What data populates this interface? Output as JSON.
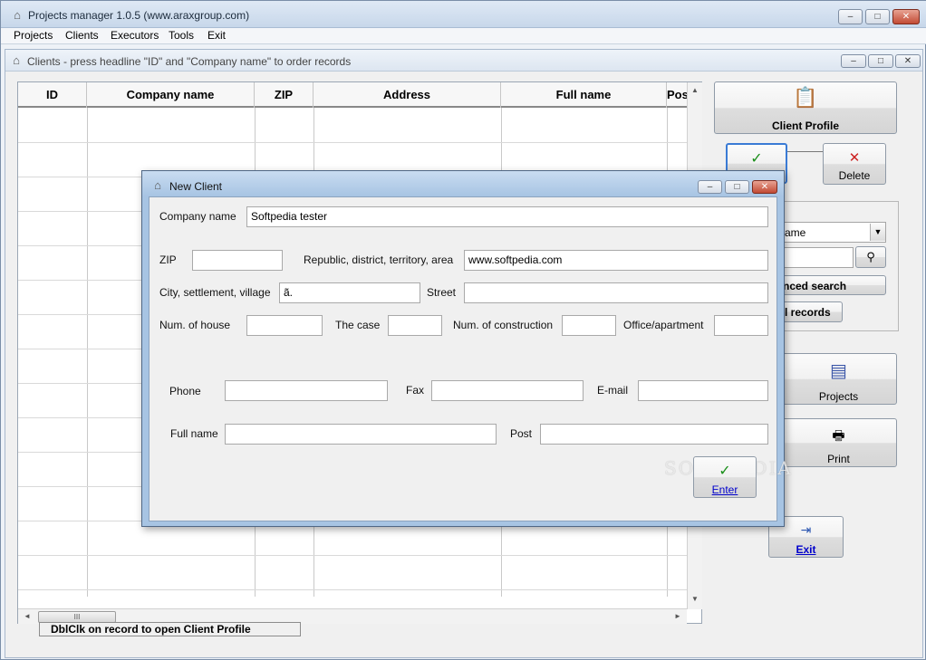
{
  "app": {
    "title": "Projects manager 1.0.5 (www.araxgroup.com)",
    "icon": "house-icon",
    "caption_buttons": {
      "minimize": "–",
      "maximize": "□",
      "close": "✕"
    }
  },
  "menu": [
    "Projects",
    "Clients",
    "Executors",
    "Tools",
    "Exit"
  ],
  "child_window": {
    "title": "Clients - press headline \"ID\" and \"Company name\" to order records",
    "caption_buttons": {
      "minimize": "–",
      "maximize": "□",
      "close": "✕"
    }
  },
  "grid": {
    "columns": [
      "ID",
      "Company name",
      "ZIP",
      "Address",
      "Full name",
      "Pos"
    ],
    "rows": [],
    "scroll_thumb_glyph": "III"
  },
  "status_hint": "DblClk on record to open Client Profile",
  "side_panel": {
    "client_profile": "Client Profile",
    "confirm_glyph": "✓",
    "delete_glyph": "✕",
    "delete": "Delete",
    "search_field_partial": "ame",
    "advanced_search_partial": "nced search",
    "all_records_partial": "l records",
    "projects": "Projects",
    "print": "Print",
    "exit": "Exit"
  },
  "dialog": {
    "title": "New Client",
    "caption_buttons": {
      "minimize": "–",
      "maximize": "□",
      "close": "✕"
    },
    "fields": {
      "company_name": {
        "label": "Company name",
        "value": "Softpedia tester"
      },
      "zip": {
        "label": "ZIP",
        "value": ""
      },
      "region": {
        "label": "Republic, district, territory, area",
        "value": "www.softpedia.com"
      },
      "city": {
        "label": "City, settlement, village",
        "value": "ã."
      },
      "street": {
        "label": "Street",
        "value": ""
      },
      "house": {
        "label": "Num. of house",
        "value": ""
      },
      "case": {
        "label": "The case",
        "value": ""
      },
      "construction": {
        "label": "Num. of construction",
        "value": ""
      },
      "office": {
        "label": "Office/apartment",
        "value": ""
      },
      "phone": {
        "label": "Phone",
        "value": ""
      },
      "fax": {
        "label": "Fax",
        "value": ""
      },
      "email": {
        "label": "E-mail",
        "value": ""
      },
      "full_name": {
        "label": "Full name",
        "value": ""
      },
      "post": {
        "label": "Post",
        "value": ""
      }
    },
    "enter_glyph": "✓",
    "enter": "Enter",
    "watermark": "SOFTPEDIA"
  },
  "colors": {
    "check_green": "#1a8f1a",
    "delete_red": "#cc2222",
    "link_blue": "#0000cc"
  }
}
